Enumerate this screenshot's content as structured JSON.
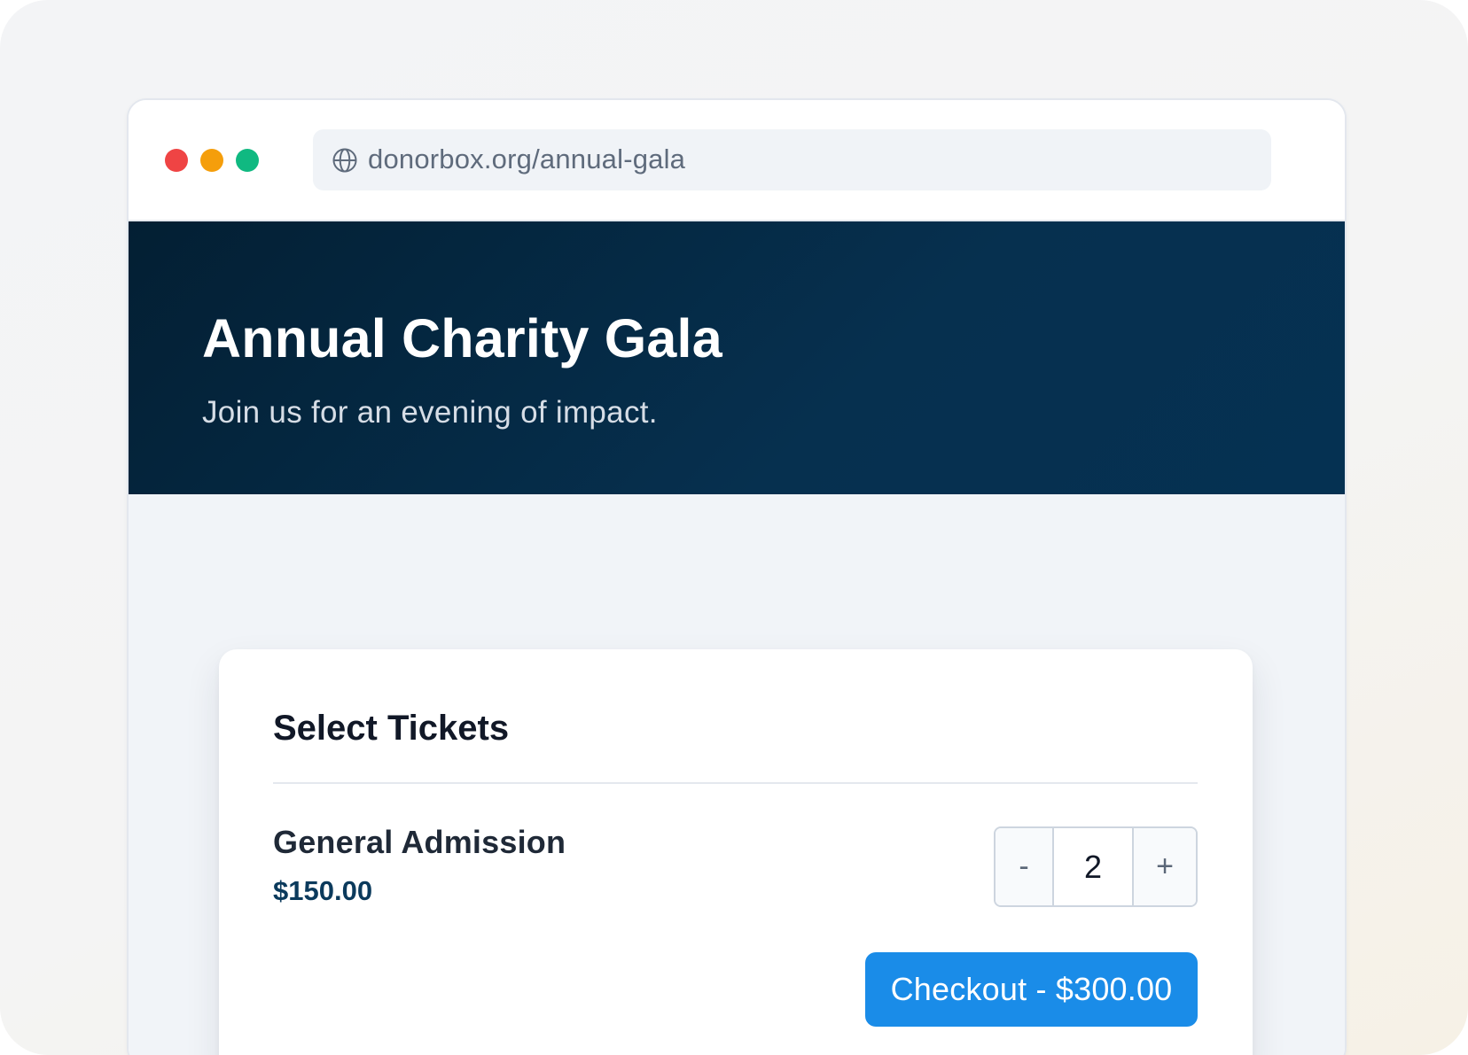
{
  "browser": {
    "url": "donorbox.org/annual-gala",
    "icons": {
      "url_icon": "globe-icon",
      "window_controls": [
        "close-dot",
        "minimize-dot",
        "maximize-dot"
      ]
    },
    "colors": {
      "close": "#ef4444",
      "minimize": "#f59e0b",
      "maximize": "#10b981"
    }
  },
  "hero": {
    "title": "Annual Charity Gala",
    "subtitle": "Join us for an evening of impact.",
    "background": "#052b47"
  },
  "ticket_card": {
    "title": "Select Tickets",
    "ticket": {
      "name": "General Admission",
      "price": "$150.00",
      "quantity": "2",
      "decrement_label": "-",
      "increment_label": "+"
    },
    "checkout_label": "Checkout - $300.00",
    "accent": "#1a8ce8"
  }
}
